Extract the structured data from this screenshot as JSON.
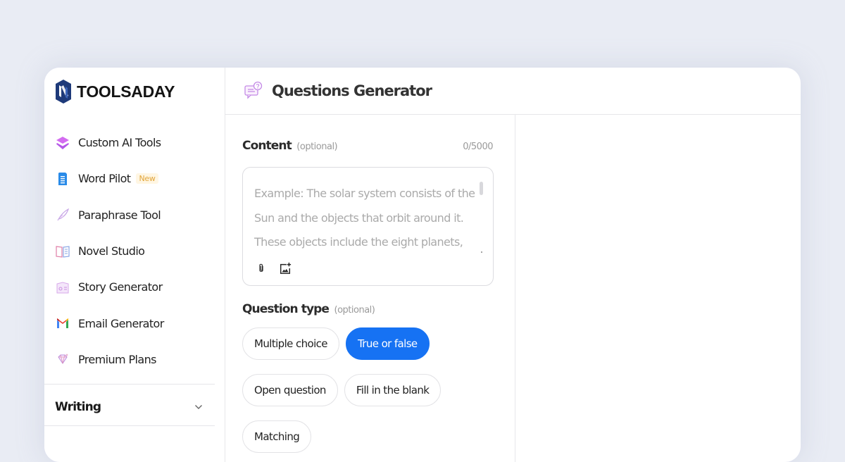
{
  "brand": {
    "name": "TOOLSADAY",
    "logo_color": "#1e3a7a"
  },
  "sidebar": {
    "items": [
      {
        "label": "Custom AI Tools",
        "icon": "layers-icon"
      },
      {
        "label": "Word Pilot",
        "icon": "document-icon",
        "badge": "New"
      },
      {
        "label": "Paraphrase Tool",
        "icon": "feather-icon"
      },
      {
        "label": "Novel Studio",
        "icon": "book-icon"
      },
      {
        "label": "Story Generator",
        "icon": "storybook-icon"
      },
      {
        "label": "Email Generator",
        "icon": "gmail-icon"
      },
      {
        "label": "Premium Plans",
        "icon": "diamond-icon"
      }
    ],
    "sections": [
      {
        "label": "Writing",
        "expanded": false
      }
    ]
  },
  "header": {
    "title": "Questions Generator",
    "icon": "chat-question-icon"
  },
  "form": {
    "content": {
      "label": "Content",
      "optional": "(optional)",
      "counter": "0/5000",
      "value": "",
      "placeholder": "Example: The solar system consists of the Sun and the objects that orbit around it. These objects include the eight planets, their"
    },
    "question_type": {
      "label": "Question type",
      "optional": "(optional)",
      "options": [
        {
          "label": "Multiple choice",
          "selected": false
        },
        {
          "label": "True or false",
          "selected": true
        },
        {
          "label": "Open question",
          "selected": false
        },
        {
          "label": "Fill in the blank",
          "selected": false
        },
        {
          "label": "Matching",
          "selected": false
        }
      ]
    },
    "tools": [
      "attach-icon",
      "add-image-icon"
    ]
  },
  "colors": {
    "accent": "#1672f3",
    "badge_text": "#e2a53a",
    "badge_bg": "#fff6e3",
    "page_bg": "#e9ecf4"
  }
}
